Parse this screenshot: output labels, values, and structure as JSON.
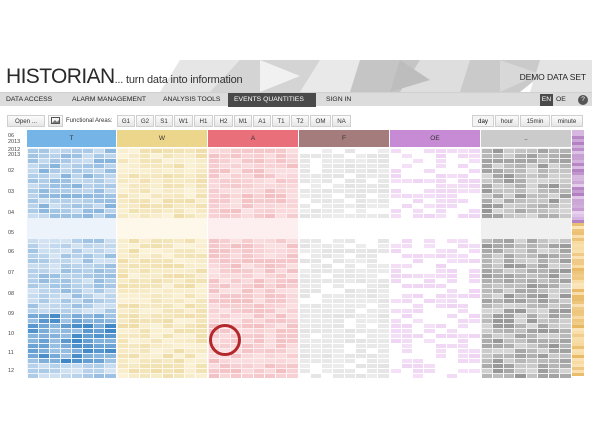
{
  "header": {
    "logo": "HISTORIAN",
    "tagline": "... turn data into information",
    "dataset": "DEMO DATA SET"
  },
  "nav": {
    "items": [
      {
        "label": "DATA ACCESS",
        "active": false
      },
      {
        "label": "ALARM MANAGEMENT",
        "active": false
      },
      {
        "label": "ANALYSIS TOOLS",
        "active": false
      },
      {
        "label": "EVENTS QUANTITIES",
        "active": true
      },
      {
        "label": "SIGN IN",
        "active": false
      }
    ],
    "lang_en": "EN",
    "lang_oe": "OE",
    "help": "?"
  },
  "toolbar": {
    "open_label": "Open ...",
    "image_icon": "image-icon",
    "functional_areas_label": "Functional Areas:",
    "areas": [
      "G1",
      "G2",
      "S1",
      "W1",
      "H1",
      "H2",
      "M1",
      "A1",
      "T1",
      "T2",
      "OM",
      "NA"
    ],
    "granularity": [
      {
        "label": "day",
        "selected": true
      },
      {
        "label": "hour",
        "selected": false
      },
      {
        "label": "15min",
        "selected": false
      },
      {
        "label": "minute",
        "selected": false
      }
    ]
  },
  "heatmap": {
    "columns": [
      {
        "label": "T",
        "header_color": "#74b4e6",
        "base_color": "#dde9f5",
        "dark_color": "#3d86c6"
      },
      {
        "label": "W",
        "header_color": "#ecd68c",
        "base_color": "#fbf3d9",
        "dark_color": "#e7cf88"
      },
      {
        "label": "A",
        "header_color": "#e9707a",
        "base_color": "#fbe1e3",
        "dark_color": "#eca9ad"
      },
      {
        "label": "F",
        "header_color": "#a47c7c",
        "base_color": "#eeeeee",
        "dark_color": "#dcdcdc"
      },
      {
        "label": "OE",
        "header_color": "#c78ad5",
        "base_color": "#f8e9fa",
        "dark_color": "#e9c8ef"
      },
      {
        "label": "..",
        "header_color": "#cbcbcb",
        "base_color": "#e3e3e3",
        "dark_color": "#8e8e8e"
      }
    ],
    "y_labels": [
      {
        "text": "06\n2013"
      },
      {
        "text": "2012"
      },
      {
        "text": "2013"
      },
      {
        "text": "02"
      },
      {
        "text": "03"
      },
      {
        "text": "04"
      },
      {
        "text": "05"
      },
      {
        "text": "06"
      },
      {
        "text": "07"
      },
      {
        "text": "08"
      },
      {
        "text": "09"
      },
      {
        "text": "10"
      },
      {
        "text": "11"
      },
      {
        "text": "12"
      }
    ],
    "side_bar_colors": [
      "#b27fc1",
      "#e7b65f",
      "#f2cc81"
    ],
    "highlight": "red-circle-marker"
  }
}
